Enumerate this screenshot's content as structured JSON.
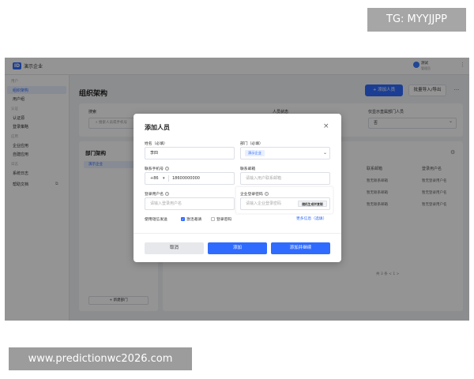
{
  "watermarks": {
    "top": "TG: MYYJJPP",
    "bottom": "www.predictionwc2026.com"
  },
  "app": {
    "logo_text": "ID",
    "name": "演示企业",
    "user_name": "测试",
    "user_sub": "管理员"
  },
  "sidebar": {
    "groups": [
      "用户",
      "认证",
      "应用",
      "日志"
    ],
    "items": [
      {
        "label": "组织架构",
        "active": true
      },
      {
        "label": "用户组"
      },
      {
        "label": "认证源"
      },
      {
        "label": "登录策略"
      },
      {
        "label": "企业应用"
      },
      {
        "label": "自建应用"
      },
      {
        "label": "系统日志"
      },
      {
        "label": "帮助文档"
      }
    ]
  },
  "main": {
    "title": "组织架构",
    "add_button": "+ 添加人员",
    "batch_button": "批量导入/导出",
    "more_button": "···",
    "filter": {
      "search_label": "搜索",
      "search_placeholder": "搜索人员或手机号",
      "status_label": "人员状态",
      "dept_label": "仅显示直属部门人员",
      "dept_value": "否"
    },
    "dept_panel": {
      "title": "部门架构",
      "root": "演示企业",
      "add_dept": "+ 新建部门"
    },
    "table": {
      "headers": [
        "联系邮箱",
        "登录用户名"
      ],
      "rows": [
        [
          "暂无联系邮箱",
          "暂无登录用户名"
        ],
        [
          "暂无联系邮箱",
          "暂无登录用户名"
        ],
        [
          "暂无联系邮箱",
          "暂无登录用户名"
        ]
      ],
      "pager": "共 3 条 < 1 >"
    }
  },
  "modal": {
    "title": "添加人员",
    "close": "×",
    "name_label": "姓名（必填）",
    "name_value": "李四",
    "dept_label": "部门（必填）",
    "dept_value": "演示企业",
    "phone_label": "联系手机号",
    "phone_prefix": "+86",
    "phone_value": "18600000000",
    "email_label": "联系邮箱",
    "email_placeholder": "请输入用户联系邮箱",
    "username_label": "登录用户名",
    "username_placeholder": "请输入登录用户名",
    "password_label": "企业登录密码",
    "password_placeholder": "请输入企业登录密码",
    "password_generate": "随机生成并复制",
    "notify_label": "使用短信发送",
    "notify_invite": "激活邀请",
    "notify_password": "登录密码",
    "more_info_link": "更多信息（选填）",
    "cancel_button": "取消",
    "add_button": "添加",
    "add_continue_button": "添加并继续"
  },
  "colors": {
    "accent": "#2f6bff",
    "overlay": "rgba(0,0,0,0.42)"
  }
}
